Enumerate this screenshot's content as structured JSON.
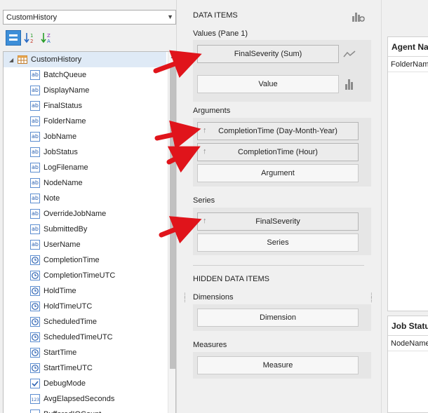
{
  "left_panel": {
    "datasource": "CustomHistory",
    "tree_root": "CustomHistory",
    "fields": [
      {
        "label": "BatchQueue",
        "icon": "text-field-icon"
      },
      {
        "label": "DisplayName",
        "icon": "text-field-icon"
      },
      {
        "label": "FinalStatus",
        "icon": "text-field-icon"
      },
      {
        "label": "FolderName",
        "icon": "text-field-icon"
      },
      {
        "label": "JobName",
        "icon": "text-field-icon"
      },
      {
        "label": "JobStatus",
        "icon": "text-field-icon"
      },
      {
        "label": "LogFilename",
        "icon": "text-field-icon"
      },
      {
        "label": "NodeName",
        "icon": "text-field-icon"
      },
      {
        "label": "Note",
        "icon": "text-field-icon"
      },
      {
        "label": "OverrideJobName",
        "icon": "text-field-icon"
      },
      {
        "label": "SubmittedBy",
        "icon": "text-field-icon"
      },
      {
        "label": "UserName",
        "icon": "text-field-icon"
      },
      {
        "label": "CompletionTime",
        "icon": "datetime-field-icon"
      },
      {
        "label": "CompletionTimeUTC",
        "icon": "datetime-field-icon"
      },
      {
        "label": "HoldTime",
        "icon": "datetime-field-icon"
      },
      {
        "label": "HoldTimeUTC",
        "icon": "datetime-field-icon"
      },
      {
        "label": "ScheduledTime",
        "icon": "datetime-field-icon"
      },
      {
        "label": "ScheduledTimeUTC",
        "icon": "datetime-field-icon"
      },
      {
        "label": "StartTime",
        "icon": "datetime-field-icon"
      },
      {
        "label": "StartTimeUTC",
        "icon": "datetime-field-icon"
      },
      {
        "label": "DebugMode",
        "icon": "boolean-field-icon"
      },
      {
        "label": "AvgElapsedSeconds",
        "icon": "numeric-field-icon"
      },
      {
        "label": "BufferedIOCount",
        "icon": "numeric-field-icon"
      }
    ]
  },
  "data_items": {
    "header": "DATA ITEMS",
    "values_title": "Values (Pane 1)",
    "values": [
      "FinalSeverity (Sum)",
      "Value"
    ],
    "arguments_title": "Arguments",
    "arguments": [
      "CompletionTime (Day-Month-Year)",
      "CompletionTime (Hour)",
      "Argument"
    ],
    "series_title": "Series",
    "series": [
      "FinalSeverity",
      "Series"
    ]
  },
  "hidden_items": {
    "header": "HIDDEN DATA ITEMS",
    "dimensions_title": "Dimensions",
    "dimension_placeholder": "Dimension",
    "measures_title": "Measures",
    "measure_placeholder": "Measure"
  },
  "dashboard": {
    "card1_title": "Agent Na",
    "card1_column": "FolderName",
    "card2_title": "Job Statu",
    "card2_column": "NodeName"
  },
  "colors": {
    "accent": "#3d8ed8",
    "arrow": "#e0141b",
    "selection": "#dfeaf6"
  }
}
